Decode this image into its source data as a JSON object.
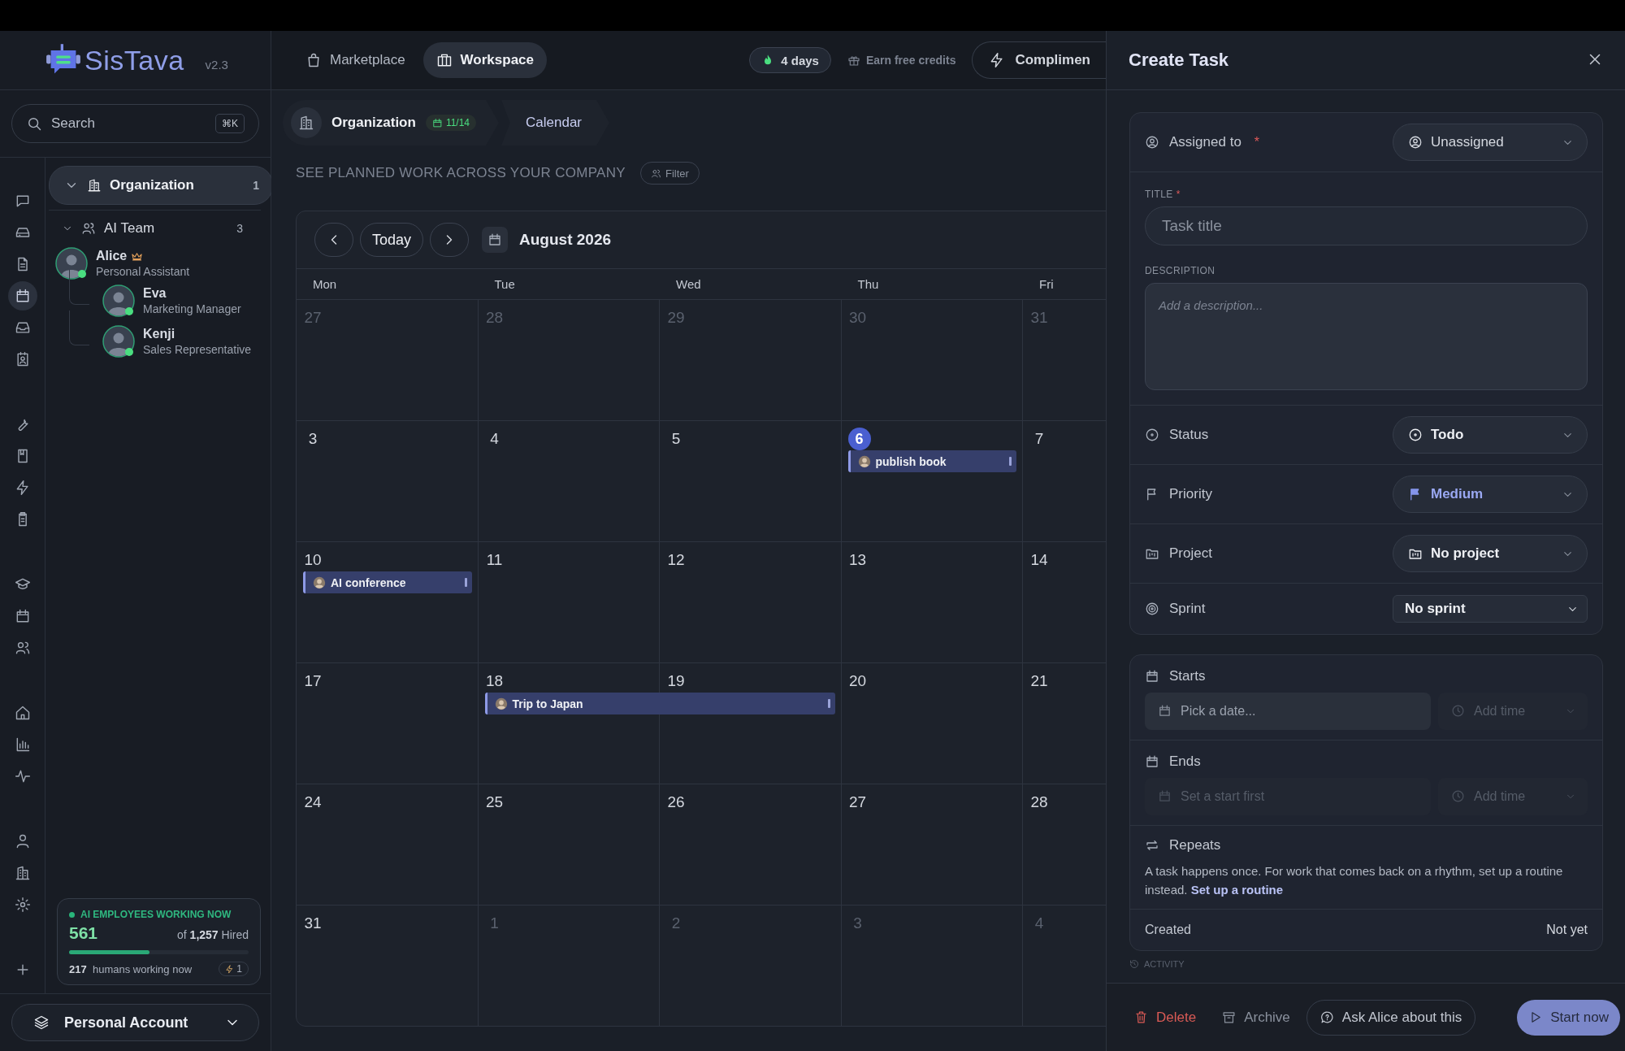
{
  "sidebar": {
    "logo": "SisTava",
    "version": "v2.3",
    "search": {
      "placeholder": "Search",
      "shortcut": "⌘K"
    },
    "rail": [
      [
        {
          "selected": false
        },
        {
          "selected": false
        },
        {
          "selected": false
        },
        {
          "selected": true
        },
        {
          "selected": false
        },
        {
          "selected": false
        }
      ],
      [
        {
          "selected": false
        },
        {
          "selected": false
        },
        {
          "selected": false
        },
        {
          "selected": false
        }
      ],
      [
        {
          "selected": false
        },
        {
          "selected": false
        },
        {
          "selected": false
        }
      ],
      [
        {
          "selected": false
        },
        {
          "selected": false
        },
        {
          "selected": false
        }
      ],
      [
        {
          "selected": false
        },
        {
          "selected": false
        },
        {
          "selected": false
        }
      ],
      [
        {
          "selected": false
        }
      ]
    ],
    "tree": [
      {
        "label": "Organization",
        "count": "1",
        "expanded": true,
        "selected": true,
        "children": [
          {
            "label": "AI Team",
            "count": "3",
            "expanded": true,
            "selected": false,
            "children": [
              {
                "name": "Alice",
                "role": "Personal Assistant",
                "lead": true,
                "online": true,
                "children": [
                  {
                    "name": "Eva",
                    "role": "Marketing Manager",
                    "lead": false,
                    "online": true
                  },
                  {
                    "name": "Kenji",
                    "role": "Sales Representative",
                    "lead": false,
                    "online": true
                  }
                ]
              }
            ]
          }
        ]
      }
    ],
    "stats": {
      "label": "AI EMPLOYEES WORKING NOW",
      "working": "561",
      "of": "of",
      "hired_count": "1,257",
      "hired": "Hired",
      "level": 0.45,
      "humans": "217",
      "humans_label": "humans working now",
      "badge": "1"
    },
    "account": "Personal Account"
  },
  "topnav": {
    "tabs": [
      {
        "label": "Marketplace",
        "selected": false
      },
      {
        "label": "Workspace",
        "selected": true
      }
    ],
    "streak": "4 days",
    "earn": "Earn free credits",
    "cut_button": "Complimen"
  },
  "breadcrumb": [
    {
      "label": "Organization",
      "badge": "11/14"
    },
    {
      "label": "Calendar"
    }
  ],
  "subtitle": "SEE PLANNED WORK ACROSS YOUR COMPANY",
  "filter": "Filter",
  "calendar": {
    "today": "Today",
    "month": "August 2026",
    "weekdays": [
      "Mon",
      "Tue",
      "Wed",
      "Thu",
      "Fri"
    ],
    "weeks": [
      [
        {
          "day": "27",
          "in_month": false,
          "today": false
        },
        {
          "day": "28",
          "in_month": false,
          "today": false
        },
        {
          "day": "29",
          "in_month": false,
          "today": false
        },
        {
          "day": "30",
          "in_month": false,
          "today": false
        },
        {
          "day": "31",
          "in_month": false,
          "today": false
        }
      ],
      [
        {
          "day": "3",
          "in_month": true,
          "today": false
        },
        {
          "day": "4",
          "in_month": true,
          "today": false
        },
        {
          "day": "5",
          "in_month": true,
          "today": false
        },
        {
          "day": "6",
          "in_month": true,
          "today": true,
          "events": [
            {
              "title": "publish book",
              "continues": false
            }
          ]
        },
        {
          "day": "7",
          "in_month": true,
          "today": false
        }
      ],
      [
        {
          "day": "10",
          "in_month": true,
          "today": false,
          "events": [
            {
              "title": "AI conference",
              "continues": false
            }
          ]
        },
        {
          "day": "11",
          "in_month": true,
          "today": false
        },
        {
          "day": "12",
          "in_month": true,
          "today": false
        },
        {
          "day": "13",
          "in_month": true,
          "today": false
        },
        {
          "day": "14",
          "in_month": true,
          "today": false
        }
      ],
      [
        {
          "day": "17",
          "in_month": true,
          "today": false
        },
        {
          "day": "18",
          "in_month": true,
          "today": false,
          "events": [
            {
              "title": "Trip to Japan",
              "continues": true
            }
          ]
        },
        {
          "day": "19",
          "in_month": true,
          "today": false
        },
        {
          "day": "20",
          "in_month": true,
          "today": false
        },
        {
          "day": "21",
          "in_month": true,
          "today": false
        }
      ],
      [
        {
          "day": "24",
          "in_month": true,
          "today": false
        },
        {
          "day": "25",
          "in_month": true,
          "today": false
        },
        {
          "day": "26",
          "in_month": true,
          "today": false
        },
        {
          "day": "27",
          "in_month": true,
          "today": false
        },
        {
          "day": "28",
          "in_month": true,
          "today": false
        }
      ],
      [
        {
          "day": "31",
          "in_month": true,
          "today": false
        },
        {
          "day": "1",
          "in_month": false,
          "today": false
        },
        {
          "day": "2",
          "in_month": false,
          "today": false
        },
        {
          "day": "3",
          "in_month": false,
          "today": false
        },
        {
          "day": "4",
          "in_month": false,
          "today": false
        }
      ]
    ]
  },
  "panel": {
    "title": "Create Task",
    "fields": [
      {
        "kind": "person-select",
        "label": "Assigned to",
        "required_mark": "*",
        "value": "Unassigned"
      },
      {
        "kind": "text",
        "label": "TITLE",
        "required_mark": "*",
        "placeholder": "Task title"
      },
      {
        "kind": "textarea",
        "label": "DESCRIPTION",
        "placeholder": "Add a description..."
      },
      {
        "kind": "status-select",
        "label": "Status",
        "value": "Todo"
      },
      {
        "kind": "priority-select",
        "label": "Priority",
        "value": "Medium"
      },
      {
        "kind": "project-select",
        "label": "Project",
        "value": "No project"
      },
      {
        "kind": "native-select",
        "label": "Sprint",
        "value": "No sprint"
      }
    ],
    "schedule": [
      {
        "label": "Starts",
        "date": {
          "placeholder": "Pick a date...",
          "disabled": false
        },
        "time": {
          "placeholder": "Add time",
          "disabled": true
        }
      },
      {
        "label": "Ends",
        "date": {
          "placeholder": "Set a start first",
          "disabled": true
        },
        "time": {
          "placeholder": "Add time",
          "disabled": true
        }
      }
    ],
    "repeats": {
      "label": "Repeats",
      "text": "A task happens once. For work that comes back on a rhythm, set up a routine instead.",
      "link": "Set up a routine"
    },
    "created": {
      "label": "Created",
      "value": "Not yet"
    },
    "activity": "ACTIVITY",
    "footer": [
      {
        "kind": "danger",
        "label": "Delete"
      },
      {
        "kind": "ghost",
        "label": "Archive"
      },
      {
        "kind": "outline",
        "label": "Ask Alice about this"
      },
      {
        "kind": "primary",
        "label": "Start now"
      }
    ]
  }
}
